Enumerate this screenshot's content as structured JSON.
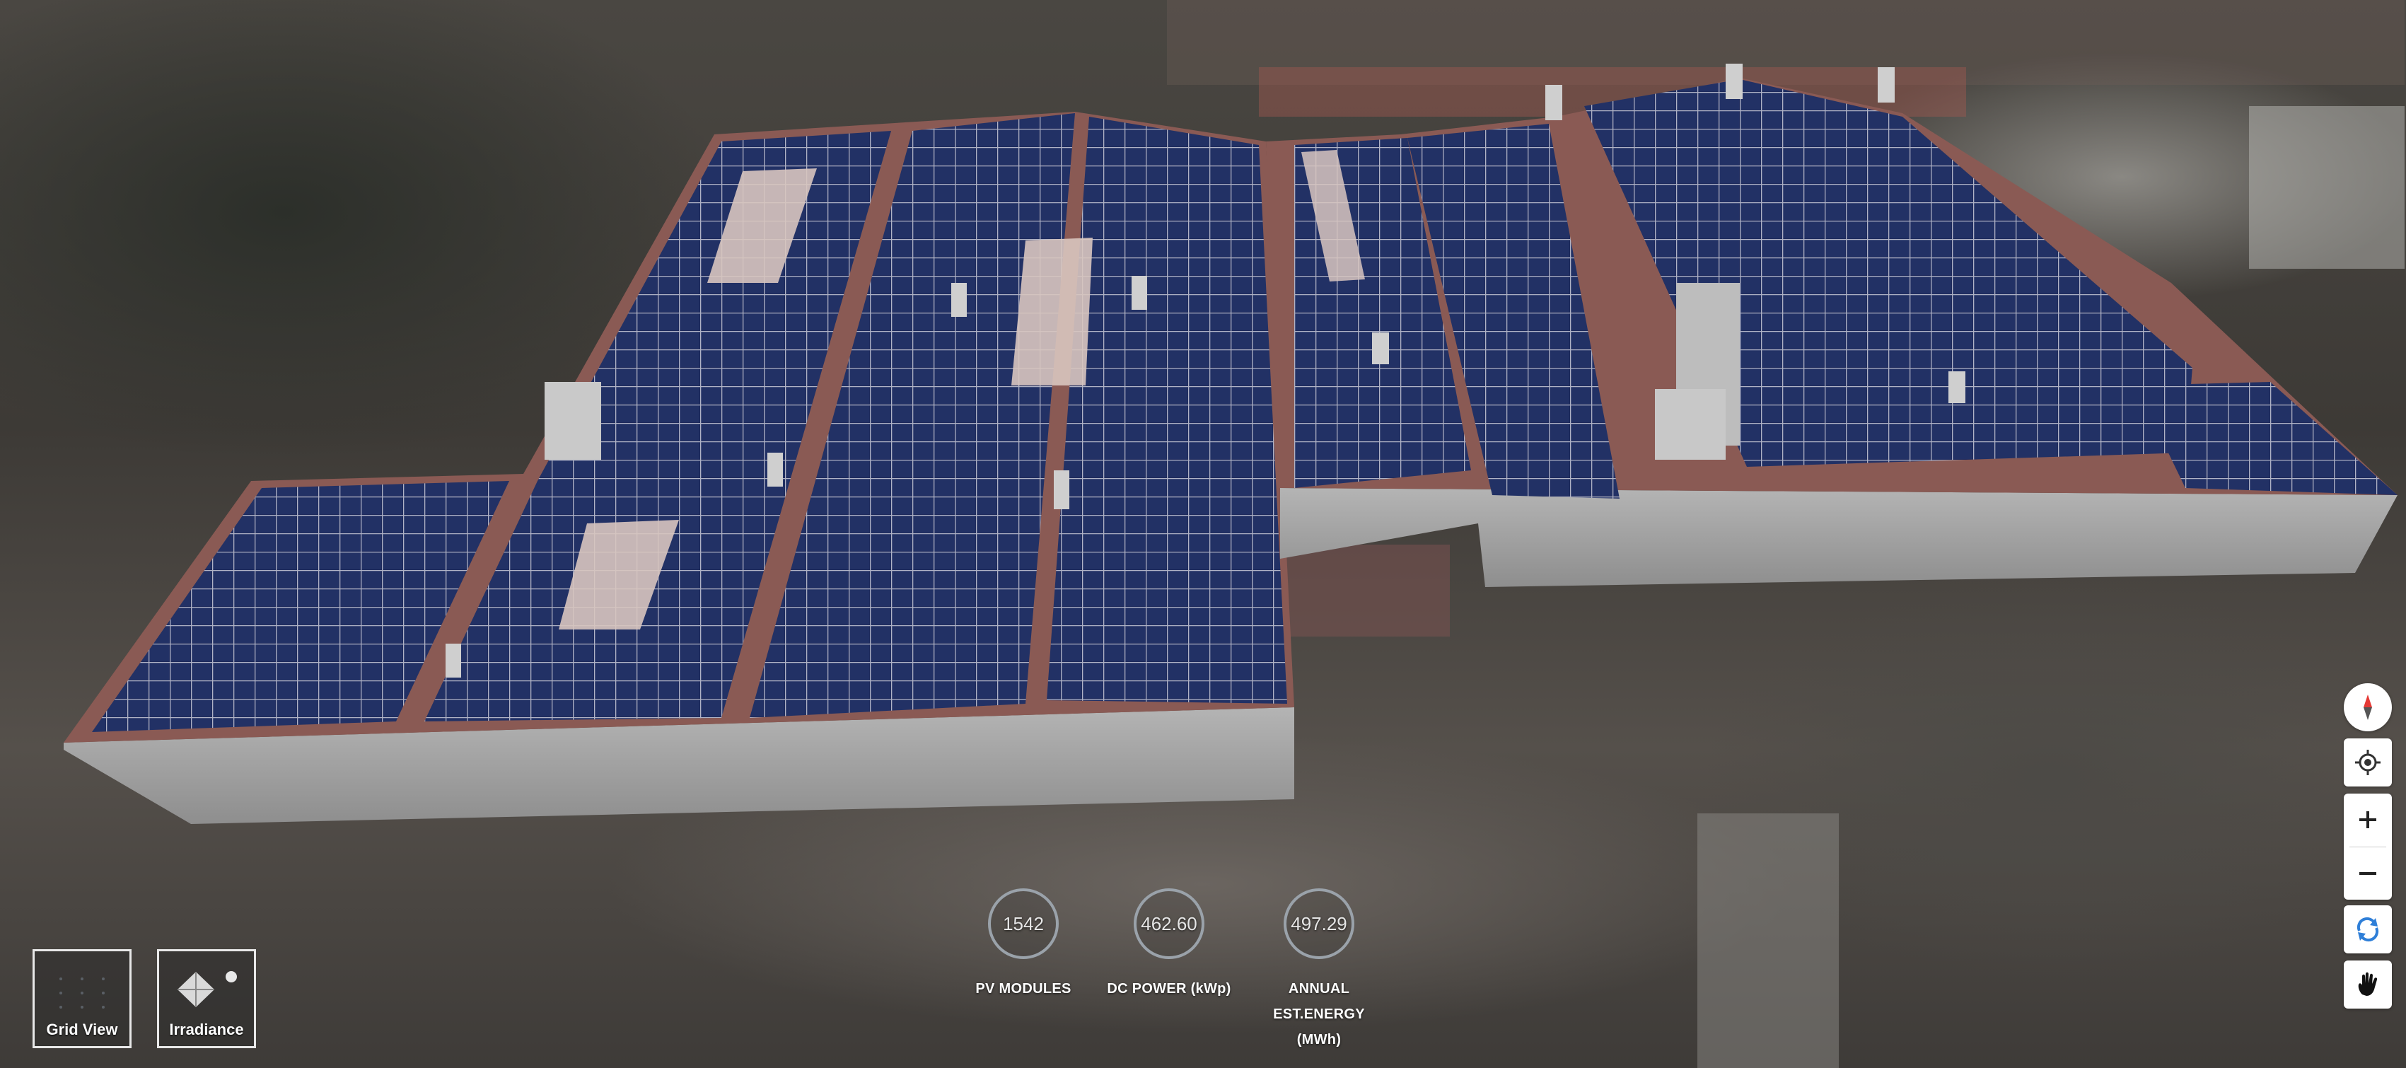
{
  "stats": [
    {
      "value": "1542",
      "label_lines": [
        "PV MODULES"
      ]
    },
    {
      "value": "462.60",
      "label_lines": [
        "DC POWER (kWp)"
      ]
    },
    {
      "value": "497.29",
      "label_lines": [
        "ANNUAL",
        "EST.ENERGY",
        "(MWh)"
      ]
    }
  ],
  "views": {
    "grid_label": "Grid View",
    "irradiance_label": "Irradiance"
  },
  "controls": [
    {
      "name": "compass-button",
      "icon": "compass-icon"
    },
    {
      "name": "locate-button",
      "icon": "crosshair-icon"
    },
    {
      "name": "zoom-in-button",
      "icon": "plus-icon"
    },
    {
      "name": "zoom-out-button",
      "icon": "minus-icon"
    },
    {
      "name": "rotate-button",
      "icon": "rotate-icon"
    },
    {
      "name": "pan-button",
      "icon": "hand-icon"
    }
  ],
  "colors": {
    "panel": "#1d2a5a",
    "roof": "#8a5a54",
    "wall": "#a4a4a4",
    "accent_blue": "#2f7fd8"
  }
}
